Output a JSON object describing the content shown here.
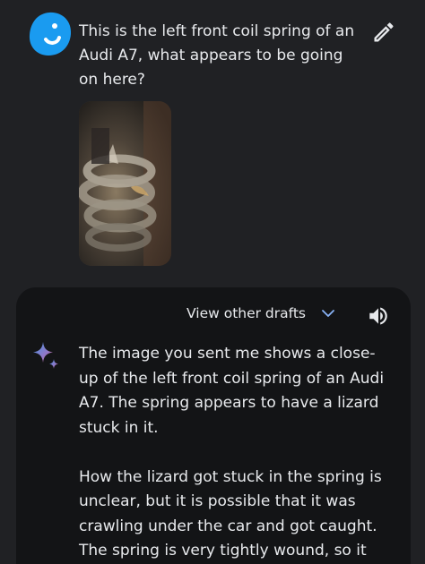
{
  "prompt": {
    "text": "This is the left front coil spring of an Audi A7, what appears to be going on here?",
    "edit_icon": "pencil-icon",
    "avatar_icon": "user-avatar-blob",
    "image": "photo-thumbnail-coil-spring"
  },
  "response": {
    "drafts_label": "View other drafts",
    "drafts_icon": "chevron-down-icon",
    "speaker_icon": "speaker-icon",
    "assistant_icon": "sparkle-icon",
    "paragraphs": [
      "The image you sent me shows a close-up of the left front coil spring of an Audi A7. The spring appears to have a lizard stuck in it.",
      "How the lizard got stuck in the spring is unclear, but it is possible that it was crawling under the car and got caught. The spring is very tightly wound, so it"
    ]
  },
  "colors": {
    "background": "#202124",
    "card": "#131416",
    "text": "#e8eaed",
    "avatar": "#1a9bf0",
    "accent": "#8ab4f8"
  }
}
